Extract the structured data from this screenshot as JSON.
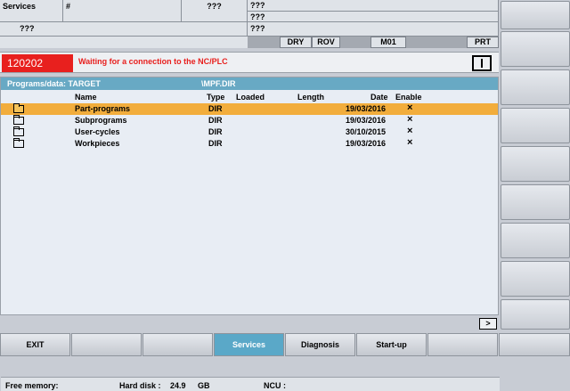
{
  "header": {
    "area": "Services",
    "hash": "#",
    "q1": "???",
    "q2": "???",
    "q3": "???",
    "q4": "???",
    "q5": "???",
    "q6": "???",
    "status": {
      "dry": "DRY",
      "rov": "ROV",
      "m01": "M01",
      "prt": "PRT"
    }
  },
  "alarm": {
    "number": "120202",
    "text": "Waiting for a connection to the NC/PLC"
  },
  "panel": {
    "path_label": "Programs/data: TARGET",
    "path_dir": "\\MPF.DIR",
    "columns": {
      "name": "Name",
      "type": "Type",
      "loaded": "Loaded",
      "length": "Length",
      "date": "Date",
      "enable": "Enable"
    },
    "rows": [
      {
        "name": "Part-programs",
        "type": "DIR",
        "loaded": "",
        "length": "",
        "date": "19/03/2016",
        "enable": "×",
        "selected": true
      },
      {
        "name": "Subprograms",
        "type": "DIR",
        "loaded": "",
        "length": "",
        "date": "19/03/2016",
        "enable": "×",
        "selected": false
      },
      {
        "name": "User-cycles",
        "type": "DIR",
        "loaded": "",
        "length": "",
        "date": "30/10/2015",
        "enable": "×",
        "selected": false
      },
      {
        "name": "Workpieces",
        "type": "DIR",
        "loaded": "",
        "length": "",
        "date": "19/03/2016",
        "enable": "×",
        "selected": false
      }
    ],
    "footer": {
      "free_memory": "Free memory:",
      "hard_disk": "Hard disk :",
      "hard_disk_val": "24.9",
      "hard_disk_unit": "GB",
      "ncu": "NCU :"
    }
  },
  "more_label": ">",
  "softkeys": [
    "EXIT",
    "",
    "",
    "Services",
    "Diagnosis",
    "Start-up",
    "",
    ""
  ],
  "active_softkey": 3,
  "colors": {
    "selection": "#f2ad3c",
    "alarm": "#e8201e",
    "pathbar": "#68a9c4",
    "active": "#5aa8c8"
  }
}
